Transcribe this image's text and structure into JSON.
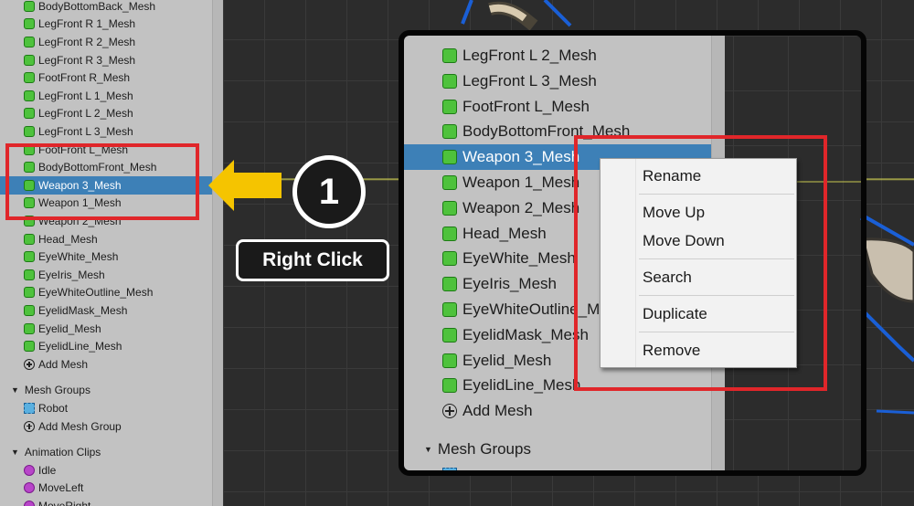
{
  "sidebar": {
    "items": [
      {
        "label": "BodyBottomBack_Mesh",
        "kind": "mesh"
      },
      {
        "label": "LegFront R 1_Mesh",
        "kind": "mesh"
      },
      {
        "label": "LegFront R 2_Mesh",
        "kind": "mesh"
      },
      {
        "label": "LegFront R 3_Mesh",
        "kind": "mesh"
      },
      {
        "label": "FootFront R_Mesh",
        "kind": "mesh"
      },
      {
        "label": "LegFront L 1_Mesh",
        "kind": "mesh"
      },
      {
        "label": "LegFront L 2_Mesh",
        "kind": "mesh"
      },
      {
        "label": "LegFront L 3_Mesh",
        "kind": "mesh"
      },
      {
        "label": "FootFront L_Mesh",
        "kind": "mesh"
      },
      {
        "label": "BodyBottomFront_Mesh",
        "kind": "mesh"
      },
      {
        "label": "Weapon 3_Mesh",
        "kind": "mesh",
        "selected": true
      },
      {
        "label": "Weapon 1_Mesh",
        "kind": "mesh"
      },
      {
        "label": "Weapon 2_Mesh",
        "kind": "mesh"
      },
      {
        "label": "Head_Mesh",
        "kind": "mesh"
      },
      {
        "label": "EyeWhite_Mesh",
        "kind": "mesh"
      },
      {
        "label": "EyeIris_Mesh",
        "kind": "mesh"
      },
      {
        "label": "EyeWhiteOutline_Mesh",
        "kind": "mesh"
      },
      {
        "label": "EyelidMask_Mesh",
        "kind": "mesh"
      },
      {
        "label": "Eyelid_Mesh",
        "kind": "mesh"
      },
      {
        "label": "EyelidLine_Mesh",
        "kind": "mesh"
      },
      {
        "label": "Add Mesh",
        "kind": "add"
      }
    ],
    "mesh_groups_header": "Mesh Groups",
    "mesh_groups": [
      {
        "label": "Robot",
        "kind": "group"
      },
      {
        "label": "Add Mesh Group",
        "kind": "add"
      }
    ],
    "animation_header": "Animation Clips",
    "animations": [
      {
        "label": "Idle",
        "kind": "anim"
      },
      {
        "label": "MoveLeft",
        "kind": "anim"
      },
      {
        "label": "MoveRight",
        "kind": "anim"
      }
    ]
  },
  "callout": {
    "step_number": "1",
    "instruction": "Right Click",
    "highlight_color": "#e0262a",
    "arrow_color": "#f5c400"
  },
  "zoom": {
    "items": [
      {
        "label": "LegFront L 2_Mesh",
        "kind": "mesh"
      },
      {
        "label": "LegFront L 3_Mesh",
        "kind": "mesh"
      },
      {
        "label": "FootFront L_Mesh",
        "kind": "mesh"
      },
      {
        "label": "BodyBottomFront_Mesh",
        "kind": "mesh"
      },
      {
        "label": "Weapon 3_Mesh",
        "kind": "mesh",
        "selected": true
      },
      {
        "label": "Weapon 1_Mesh",
        "kind": "mesh"
      },
      {
        "label": "Weapon 2_Mesh",
        "kind": "mesh"
      },
      {
        "label": "Head_Mesh",
        "kind": "mesh"
      },
      {
        "label": "EyeWhite_Mesh",
        "kind": "mesh"
      },
      {
        "label": "EyeIris_Mesh",
        "kind": "mesh"
      },
      {
        "label": "EyeWhiteOutline_Mesh",
        "kind": "mesh"
      },
      {
        "label": "EyelidMask_Mesh",
        "kind": "mesh"
      },
      {
        "label": "Eyelid_Mesh",
        "kind": "mesh"
      },
      {
        "label": "EyelidLine_Mesh",
        "kind": "mesh"
      },
      {
        "label": "Add Mesh",
        "kind": "add"
      }
    ],
    "mesh_groups_header": "Mesh Groups"
  },
  "context_menu": {
    "items": [
      "Rename",
      "Move Up",
      "Move Down",
      "Search",
      "Duplicate",
      "Remove"
    ]
  },
  "colors": {
    "selection": "#3d80b7",
    "panel": "#c2c2c2",
    "viewport": "#2c2c2c"
  }
}
